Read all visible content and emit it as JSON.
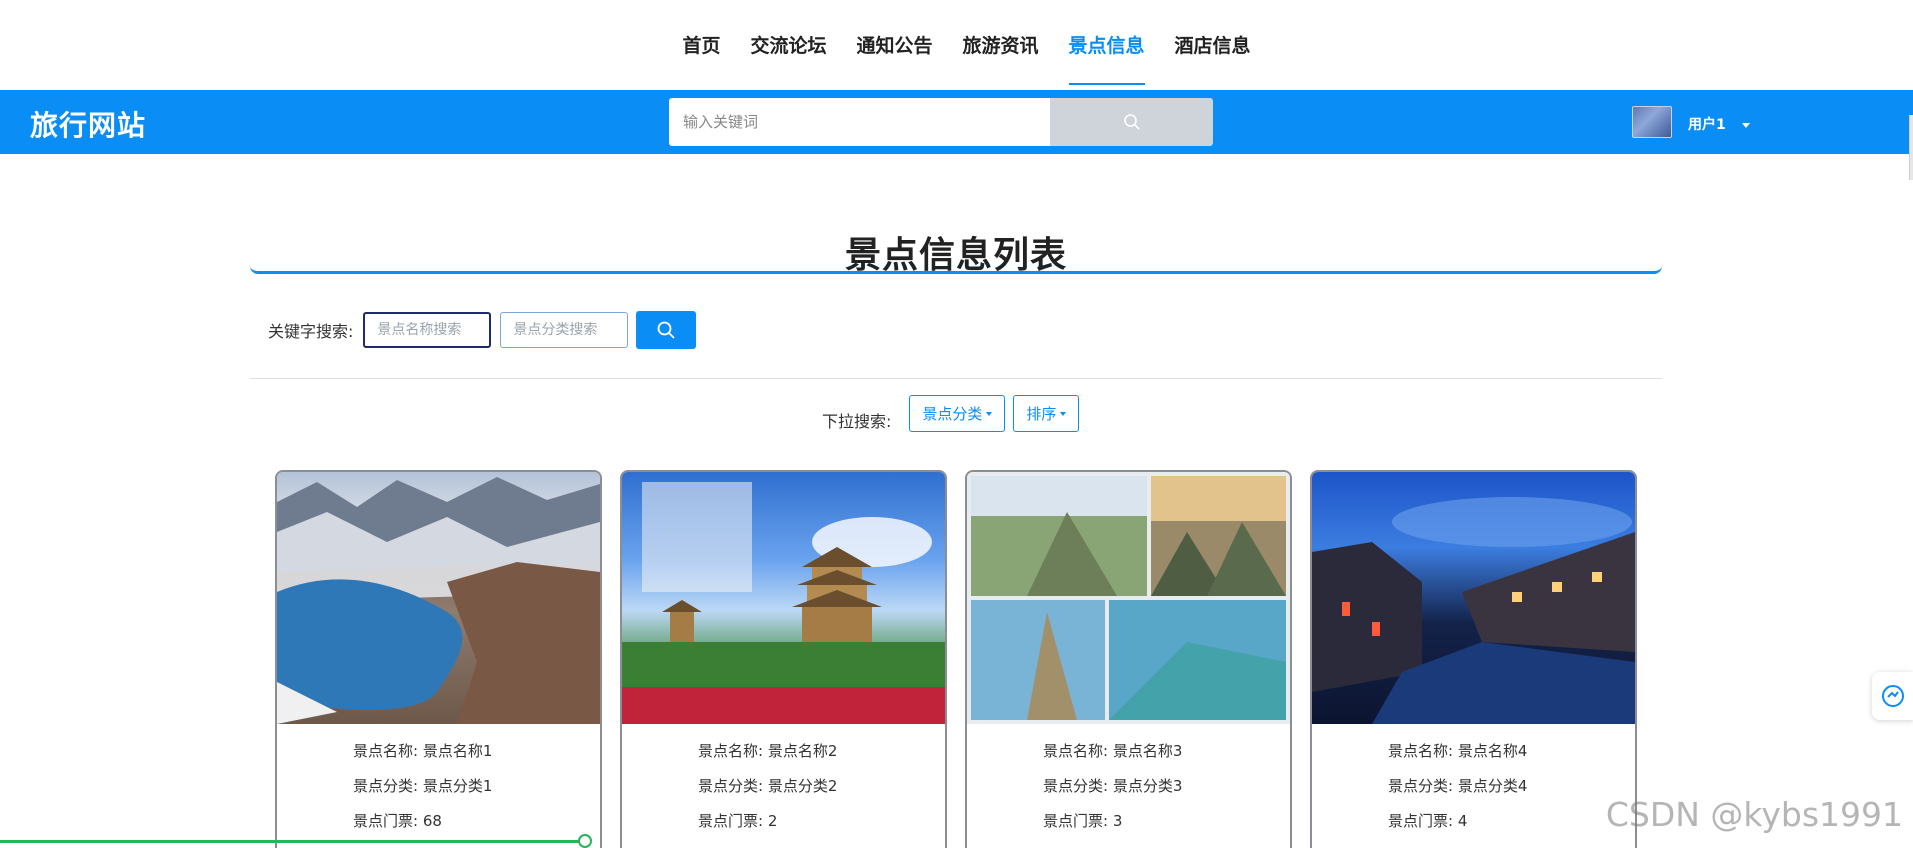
{
  "nav": {
    "items": [
      {
        "label": "首页",
        "active": false
      },
      {
        "label": "交流论坛",
        "active": false
      },
      {
        "label": "通知公告",
        "active": false
      },
      {
        "label": "旅游资讯",
        "active": false
      },
      {
        "label": "景点信息",
        "active": true
      },
      {
        "label": "酒店信息",
        "active": false
      }
    ]
  },
  "header": {
    "brand": "旅行网站",
    "search_placeholder": "输入关键词",
    "search_icon": "search-icon",
    "user_name": "用户1",
    "bg_color": "#0a8ef5"
  },
  "main": {
    "title": "景点信息列表",
    "keyword_label": "关键字搜索:",
    "name_placeholder": "景点名称搜索",
    "category_placeholder": "景点分类搜索",
    "dropdown_label": "下拉搜索:",
    "dropdown_category": "景点分类",
    "dropdown_sort": "排序"
  },
  "cards": [
    {
      "name_label": "景点名称:",
      "name": "景点名称1",
      "cat_label": "景点分类:",
      "category": "景点分类1",
      "price_label": "景点门票:",
      "price": "68"
    },
    {
      "name_label": "景点名称:",
      "name": "景点名称2",
      "cat_label": "景点分类:",
      "category": "景点分类2",
      "price_label": "景点门票:",
      "price": "2"
    },
    {
      "name_label": "景点名称:",
      "name": "景点名称3",
      "cat_label": "景点分类:",
      "category": "景点分类3",
      "price_label": "景点门票:",
      "price": "3"
    },
    {
      "name_label": "景点名称:",
      "name": "景点名称4",
      "cat_label": "景点分类:",
      "category": "景点分类4",
      "price_label": "景点门票:",
      "price": "4"
    }
  ],
  "watermark": "CSDN @kybs1991",
  "colors": {
    "accent": "#0a8ef5",
    "progress": "#2bb457"
  }
}
